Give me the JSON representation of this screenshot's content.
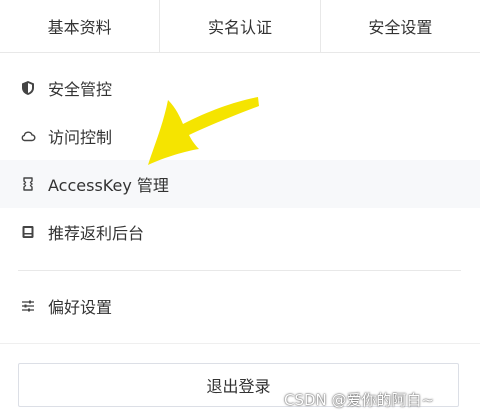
{
  "tabs": [
    {
      "label": "基本资料"
    },
    {
      "label": "实名认证"
    },
    {
      "label": "安全设置"
    }
  ],
  "menu": {
    "items": [
      {
        "label": "安全管控",
        "icon": "shield-icon"
      },
      {
        "label": "访问控制",
        "icon": "cloud-icon"
      },
      {
        "label": "AccessKey 管理",
        "icon": "key-frame-icon"
      },
      {
        "label": "推荐返利后台",
        "icon": "inbox-icon"
      },
      {
        "label": "偏好设置",
        "icon": "sliders-icon"
      }
    ]
  },
  "logout": {
    "label": "退出登录"
  },
  "watermark": {
    "text": "CSDN @爱你的阿白~"
  },
  "colors": {
    "annotation_arrow": "#f5e400",
    "highlight_row": "#f7f8fa",
    "border": "#e8e8e8"
  }
}
